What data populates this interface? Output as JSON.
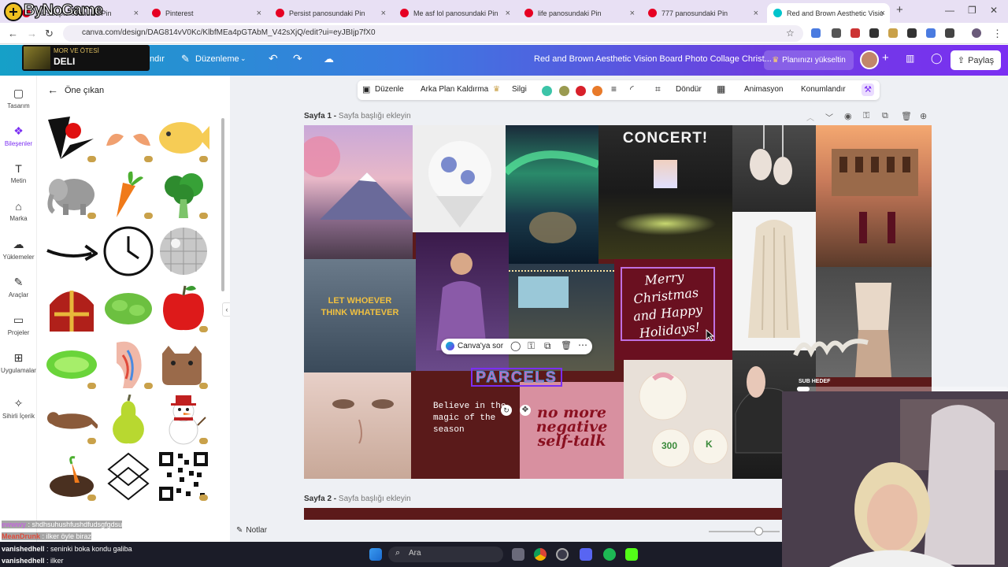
{
  "browser": {
    "tabs": [
      {
        "label": "Persist panosundaki Pin",
        "icon": "pinterest-icon",
        "active": false
      },
      {
        "label": "Pinterest",
        "icon": "pinterest-icon",
        "active": false
      },
      {
        "label": "Persist panosundaki Pin",
        "icon": "pinterest-icon",
        "active": false
      },
      {
        "label": "Me asf lol panosundaki Pin",
        "icon": "pinterest-icon",
        "active": false
      },
      {
        "label": "life panosundaki Pin",
        "icon": "pinterest-icon",
        "active": false
      },
      {
        "label": "777 panosundaki Pin",
        "icon": "pinterest-icon",
        "active": false
      },
      {
        "label": "Red and Brown Aesthetic Visio",
        "icon": "canva-icon",
        "active": true
      }
    ],
    "url": "canva.com/design/DAG814vV0Kc/KlbfMEa4pGTAbM_V42sXjQ/edit?ui=eyJBIjp7fX0"
  },
  "canva": {
    "topbar": {
      "resize": "ndır",
      "edit": "Düzenleme",
      "doc_title": "Red and Brown Aesthetic Vision Board Photo Collage Christ...",
      "upgrade": "Planınızı yükseltin",
      "share": "Paylaş"
    },
    "rail": [
      {
        "label": "Tasarım",
        "icon": "design-icon"
      },
      {
        "label": "Bileşenler",
        "icon": "elements-icon",
        "active": true
      },
      {
        "label": "Metin",
        "icon": "text-icon"
      },
      {
        "label": "Marka",
        "icon": "brand-icon"
      },
      {
        "label": "Yüklemeler",
        "icon": "upload-icon"
      },
      {
        "label": "Araçlar",
        "icon": "tools-icon"
      },
      {
        "label": "Projeler",
        "icon": "folder-icon"
      },
      {
        "label": "Uygulamalar",
        "icon": "apps-icon"
      },
      {
        "label": "Sihirli İçerik",
        "icon": "magic-icon"
      }
    ],
    "panel": {
      "title": "Öne çıkan"
    },
    "toolbar": {
      "edit": "Düzenle",
      "bg_remove": "Arka Plan Kaldırma",
      "erase": "Silgi",
      "swatches": [
        "#3cc4a8",
        "#9a9a50",
        "#d8202a",
        "#e87a2a"
      ],
      "rotate": "Döndür",
      "animate": "Animasyon",
      "position": "Konumlandır"
    },
    "page1_label": "Sayfa 1 -",
    "page1_hint": "Sayfa başlığı ekleyin",
    "page2_label": "Sayfa 2 -",
    "page2_hint": "Sayfa başlığı ekleyin",
    "collage": {
      "concert": "CONCERT!",
      "let_whoever": "LET WHOEVER THINK WHATEVER",
      "merry": "Merry Christmas and Happy Holidays!",
      "parcels": "PARCELS",
      "believe": "Believe in the magic of the season",
      "no_more": "no more negative self-talk",
      "cookie_a": "300",
      "cookie_b": "K"
    },
    "context_menu": {
      "ask": "Canva'ya sor"
    },
    "notes": "Notlar"
  },
  "taskbar": {
    "search": "Ara"
  },
  "overlay": {
    "logo": "ByNoGame",
    "now_playing_small": "MOR VE ÖTESİ",
    "now_playing_big": "DELI",
    "subgoal": "SUB HEDEF",
    "subgoal_progress": 0.06,
    "chat": [
      {
        "user": "ewwwy",
        "msg": "shdhsuhushfushdfudsgfgdsu",
        "color": "#c06ad8"
      },
      {
        "user": "MeanDrunk",
        "msg": "ilker öyle biraz",
        "color": "#e04a3a"
      },
      {
        "user": "vanishedhell",
        "msg": "seninki boka kondu galiba",
        "color": "#ffffff"
      },
      {
        "user": "vanishedhell",
        "msg": "ilker",
        "color": "#ffffff"
      }
    ]
  }
}
